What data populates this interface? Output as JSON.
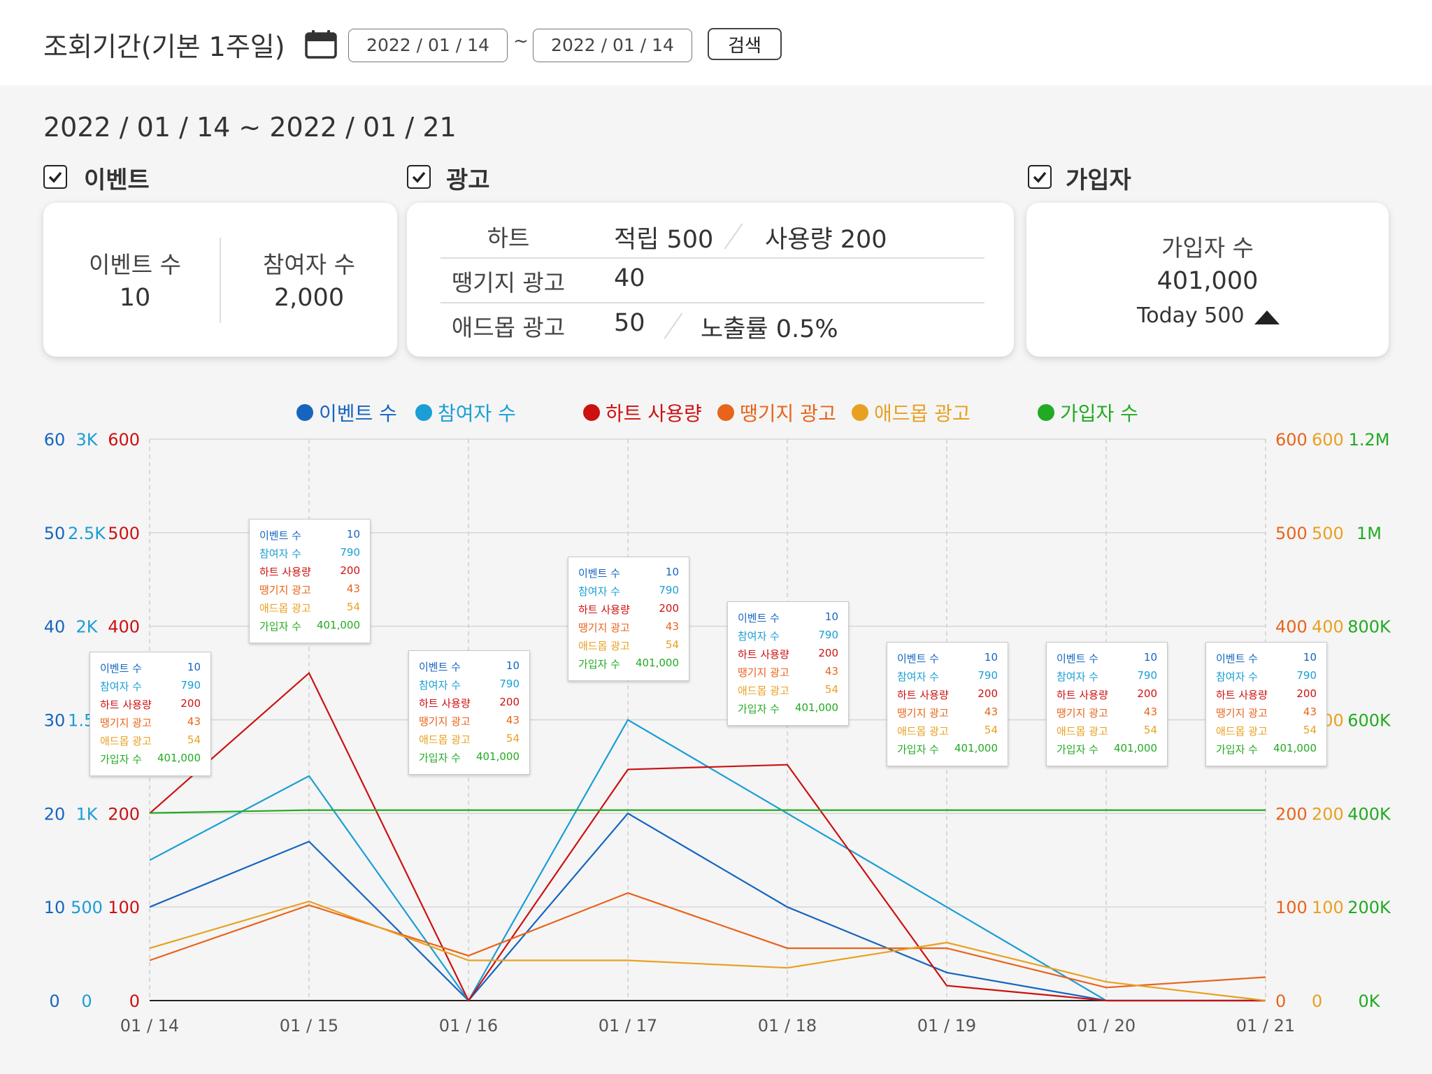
{
  "header": {
    "title": "조회기간(기본 1주일)",
    "start_date": "2022 / 01 / 14",
    "tilde": "~",
    "end_date": "2022 / 01 / 14",
    "search_label": "검색"
  },
  "range_text": "2022 / 01 / 14 ~ 2022 / 01 / 21",
  "sections": {
    "event": {
      "label": "이벤트",
      "checked": true
    },
    "ad": {
      "label": "광고",
      "checked": true
    },
    "signup": {
      "label": "가입자",
      "checked": true
    }
  },
  "event_card": {
    "event_count_label": "이벤트 수",
    "event_count_value": "10",
    "participant_label": "참여자 수",
    "participant_value": "2,000"
  },
  "ad_card": {
    "heart_label": "하트",
    "heart_earned": "적립 500",
    "heart_used": "사용량 200",
    "ttaeng_label": "땡기지 광고",
    "ttaeng_value": "40",
    "admob_label": "애드몹 광고",
    "admob_value": "50",
    "admob_exposure": "노출률 0.5%"
  },
  "signup_card": {
    "label": "가입자 수",
    "value": "401,000",
    "today": "Today 500",
    "trend_icon": "triangle-up-icon"
  },
  "colors": {
    "event_count": "#1565c0",
    "participants": "#1a9ed4",
    "heart": "#cc1111",
    "ttaeng": "#e8641a",
    "admob": "#e8a020",
    "signup": "#22aa22"
  },
  "chart_data": {
    "type": "line",
    "categories": [
      "01 / 14",
      "01 / 15",
      "01 / 16",
      "01 / 17",
      "01 / 18",
      "01 / 19",
      "01 / 20",
      "01 / 21"
    ],
    "legend_position": "top",
    "grid": true,
    "series": [
      {
        "key": "event_count",
        "name": "이벤트 수",
        "axis": "left1",
        "values": [
          10,
          17,
          0,
          20,
          10,
          3,
          0,
          0
        ]
      },
      {
        "key": "participants",
        "name": "참여자 수",
        "axis": "left2",
        "values": [
          750,
          1200,
          0,
          1500,
          1000,
          500,
          0,
          0
        ]
      },
      {
        "key": "heart",
        "name": "하트 사용량",
        "axis": "left3",
        "values": [
          200,
          350,
          0,
          247,
          252,
          16,
          0,
          0
        ]
      },
      {
        "key": "ttaeng",
        "name": "땡기지 광고",
        "axis": "right1",
        "values": [
          43,
          102,
          48,
          115,
          56,
          56,
          14,
          25
        ]
      },
      {
        "key": "admob",
        "name": "애드몹 광고",
        "axis": "right2",
        "values": [
          56,
          106,
          43,
          43,
          35,
          62,
          20,
          0
        ]
      },
      {
        "key": "signup",
        "name": "가입자 수",
        "axis": "right3",
        "values": [
          401000,
          407000,
          407000,
          407000,
          407000,
          407000,
          407000,
          407000
        ]
      }
    ],
    "axes": {
      "left1": {
        "ticks": [
          "0",
          "10",
          "20",
          "30",
          "40",
          "50",
          "60"
        ],
        "ylim": [
          0,
          60
        ]
      },
      "left2": {
        "ticks": [
          "0",
          "500",
          "1K",
          "1.5K",
          "2K",
          "2.5K",
          "3K"
        ],
        "ylim": [
          0,
          3000
        ]
      },
      "left3": {
        "ticks": [
          "0",
          "100",
          "200",
          "300",
          "400",
          "500",
          "600"
        ],
        "ylim": [
          0,
          600
        ]
      },
      "right1": {
        "ticks": [
          "0",
          "100",
          "200",
          "300",
          "400",
          "500",
          "600"
        ],
        "ylim": [
          0,
          600
        ]
      },
      "right2": {
        "ticks": [
          "0",
          "100",
          "200",
          "300",
          "400",
          "500",
          "600"
        ],
        "ylim": [
          0,
          600
        ]
      },
      "right3": {
        "ticks": [
          "0K",
          "200K",
          "400K",
          "600K",
          "800K",
          "1M",
          "1.2M"
        ],
        "ylim": [
          0,
          1200000
        ]
      }
    },
    "tooltip": {
      "rows": [
        {
          "key": "event_count",
          "label": "이벤트 수",
          "value": "10"
        },
        {
          "key": "participants",
          "label": "참여자 수",
          "value": "790"
        },
        {
          "key": "heart",
          "label": "하트 사용량",
          "value": "200"
        },
        {
          "key": "ttaeng",
          "label": "땡기지 광고",
          "value": "43"
        },
        {
          "key": "admob",
          "label": "애드몹 광고",
          "value": "54"
        },
        {
          "key": "signup",
          "label": "가입자 수",
          "value": "401,000"
        }
      ]
    }
  }
}
